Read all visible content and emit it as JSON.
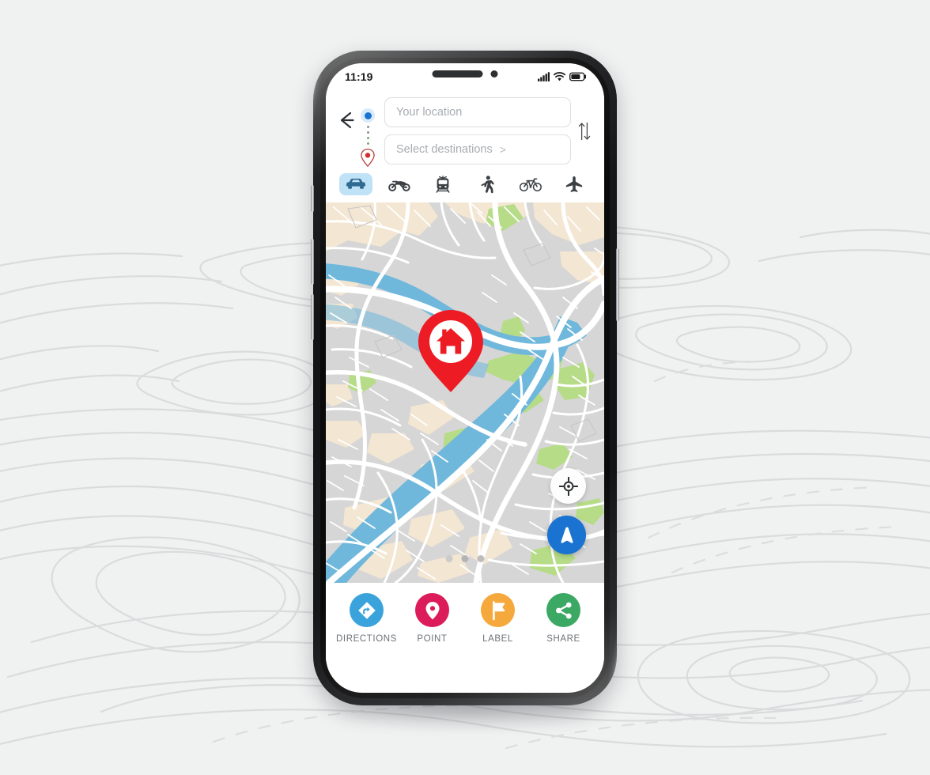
{
  "background": {
    "style": "topographic-contour-lines",
    "base_color": "#f0f1f1",
    "line_color": "#d8d9da"
  },
  "device": {
    "type": "smartphone-mockup",
    "frame_color": "#1b1c1e",
    "screen_background": "#ffffff"
  },
  "status_bar": {
    "time": "11:19",
    "icons": [
      "signal-bars-icon",
      "wifi-icon",
      "battery-icon"
    ],
    "notch": [
      "speaker-pill",
      "front-camera-dot"
    ]
  },
  "route_panel": {
    "back_icon": "back-arrow-icon",
    "origin": {
      "marker": "origin-dot-icon",
      "placeholder": "Your location",
      "value": ""
    },
    "destination": {
      "marker": "destination-pin-icon",
      "placeholder": "Select destinations",
      "chevron": ">",
      "value": ""
    },
    "swap_icon": "swap-vertical-icon",
    "accent_color": "#1a73d0",
    "destination_color": "#c0392b"
  },
  "transport_modes": {
    "selected_index": 0,
    "selected_bg": "#bfe2f7",
    "items": [
      {
        "id": "car",
        "icon": "car-icon",
        "label": "Car"
      },
      {
        "id": "motorcycle",
        "icon": "motorcycle-icon",
        "label": "Motorcycle"
      },
      {
        "id": "transit",
        "icon": "tram-icon",
        "label": "Transit"
      },
      {
        "id": "walk",
        "icon": "walking-icon",
        "label": "Walk"
      },
      {
        "id": "bicycle",
        "icon": "bicycle-icon",
        "label": "Bicycle"
      },
      {
        "id": "flight",
        "icon": "airplane-icon",
        "label": "Flight"
      }
    ]
  },
  "map": {
    "land_color": "#d6d6d6",
    "block_color": "#f3e6d2",
    "water_color": "#6fb8dc",
    "park_color": "#b6dc87",
    "road_color": "#ffffff",
    "pin": {
      "icon": "home-pin-icon",
      "color": "#ed1c24",
      "inner_icon": "house-icon"
    },
    "locate_button": {
      "icon": "crosshair-icon",
      "color": "#ffffff"
    },
    "navigate_button": {
      "icon": "navigation-arrow-icon",
      "color": "#1a73d0"
    },
    "pagination": {
      "count": 3,
      "active_index": 1,
      "color": "#c9c9c9",
      "active_color": "#b4b4b4"
    }
  },
  "actions": [
    {
      "id": "directions",
      "label": "DIRECTIONS",
      "icon": "directions-icon",
      "color": "#3ba3dc"
    },
    {
      "id": "point",
      "label": "POINT",
      "icon": "map-pin-icon",
      "color": "#db1b5a"
    },
    {
      "id": "label",
      "label": "LABEL",
      "icon": "flag-icon",
      "color": "#f5a93c"
    },
    {
      "id": "share",
      "label": "SHARE",
      "icon": "share-icon",
      "color": "#3ba863"
    }
  ]
}
